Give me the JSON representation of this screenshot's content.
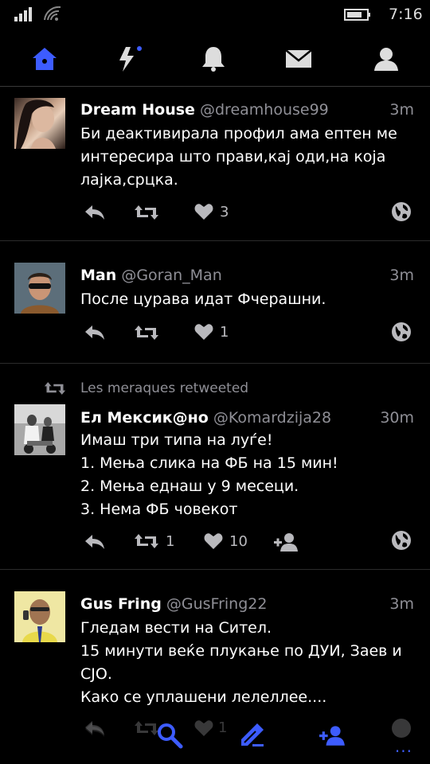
{
  "status_bar": {
    "time": "7:16"
  },
  "tabs": [
    {
      "name": "home-icon",
      "active": true
    },
    {
      "name": "lightning-icon",
      "active": false
    },
    {
      "name": "bell-icon",
      "active": false
    },
    {
      "name": "mail-icon",
      "active": false
    },
    {
      "name": "profile-icon",
      "active": false
    }
  ],
  "accent_color": "#3d5cff",
  "tweets": [
    {
      "name": "Dream House",
      "handle": "@dreamhouse99",
      "age": "3m",
      "lines": [
        "Би деактивирала профил ама ептен ме",
        "интересира што прави,кај оди,на која",
        "лајка,срцка."
      ],
      "likes": "3",
      "retweets": ""
    },
    {
      "name": "Man",
      "handle": "@Goran_Man",
      "age": "3m",
      "lines": [
        "После цурава идат Фчерашни."
      ],
      "likes": "1",
      "retweets": ""
    },
    {
      "retweeted_by": "Les meraques retweeted",
      "name": "Ел Мексик@но",
      "handle": "@Komardzija28",
      "age": "30m",
      "lines": [
        "Имаш три типа на луѓе!",
        "1. Мења слика на ФБ на 15 мин!",
        "2. Мења еднаш у 9 месеци.",
        "3. Нема ФБ човекот"
      ],
      "retweets": "1",
      "likes": "10"
    },
    {
      "name": "Gus Fring",
      "handle": "@GusFring22",
      "age": "3m",
      "lines": [
        "Гледам вести на Сител.",
        "15 минути веќе плукање по ДУИ, Заев и",
        "СЈО.",
        "Како се уплашени лелеллее...."
      ],
      "likes": "1",
      "retweets": ""
    }
  ],
  "app_bar": {
    "items": [
      "search-icon",
      "compose-icon",
      "add-user-icon"
    ],
    "more": "..."
  }
}
